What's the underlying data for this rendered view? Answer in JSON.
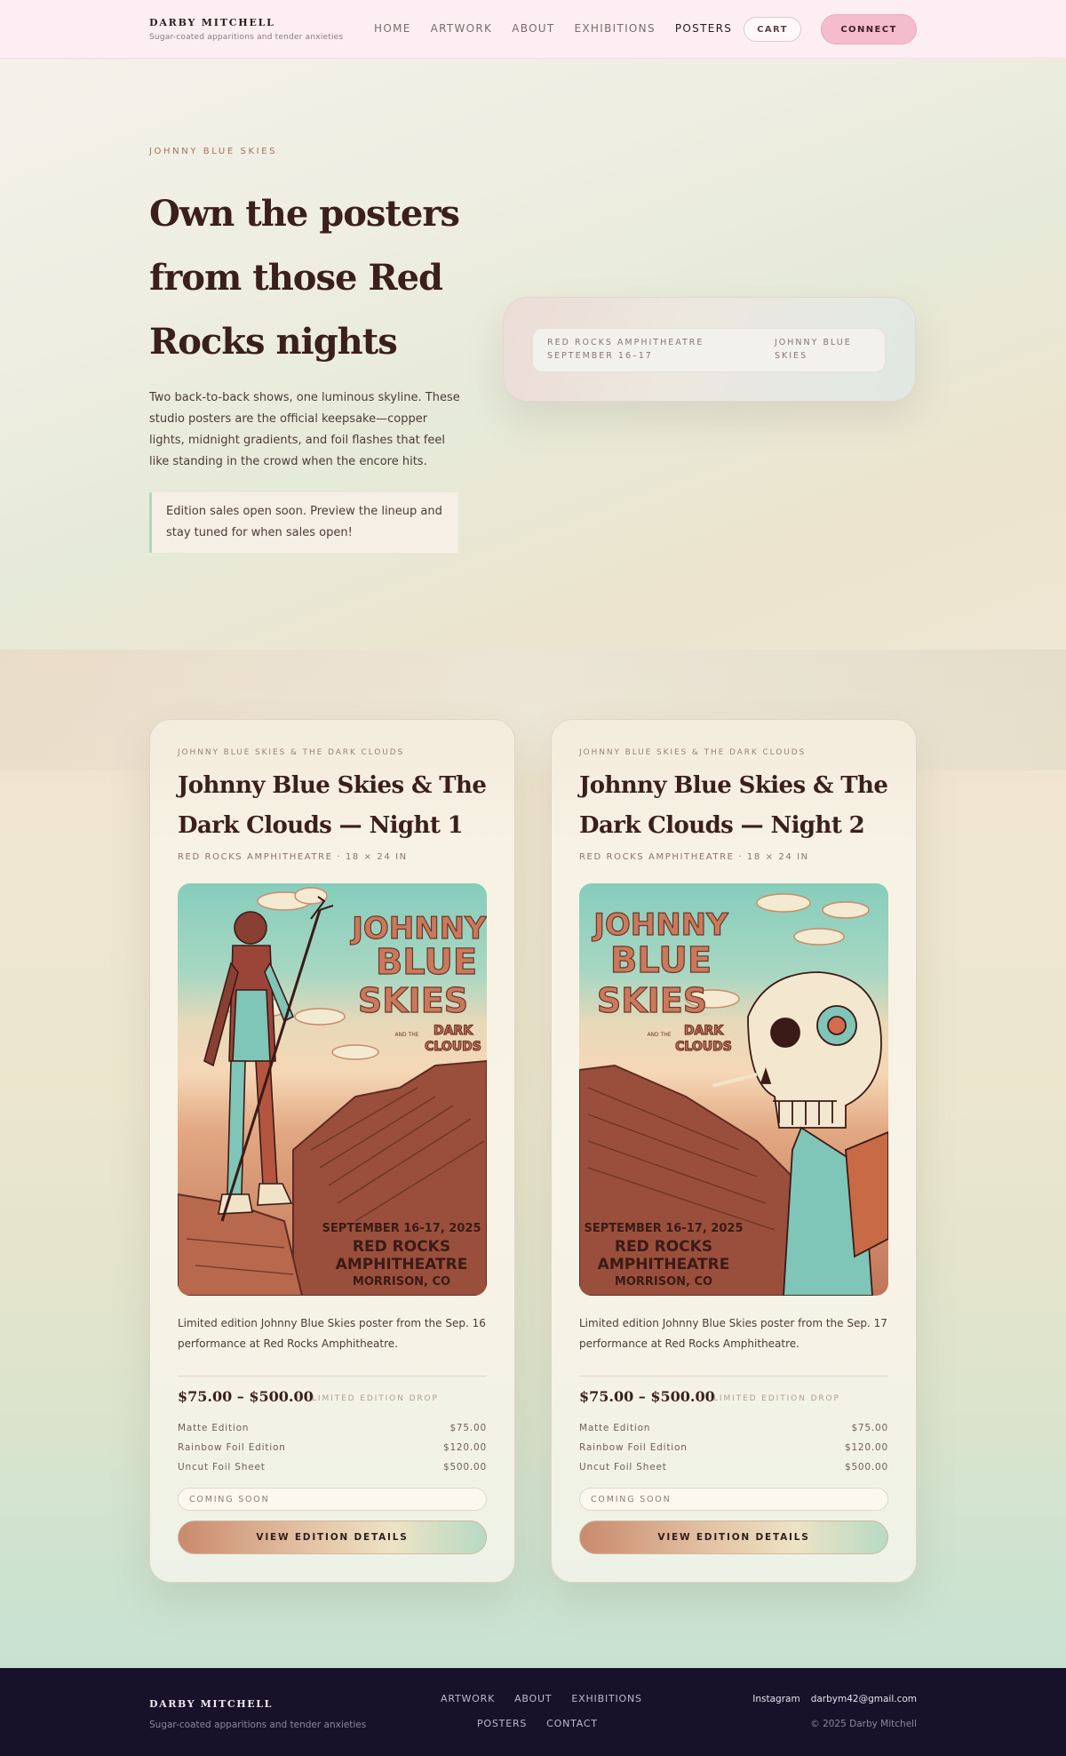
{
  "header": {
    "brand_name": "DARBY MITCHELL",
    "brand_tagline": "Sugar-coated apparitions and tender anxieties",
    "nav": [
      "HOME",
      "ARTWORK",
      "ABOUT",
      "EXHIBITIONS",
      "POSTERS"
    ],
    "active_nav": "POSTERS",
    "cart_label": "CART",
    "connect_label": "CONNECT"
  },
  "hero": {
    "eyebrow": "JOHNNY BLUE SKIES",
    "title": "Own the posters from those Red Rocks nights",
    "paragraph": "Two back-to-back shows, one luminous skyline. These studio posters are the official keepsake—copper lights, midnight gradients, and foil flashes that feel like standing in the crowd when the encore hits.",
    "notice": "Edition sales open soon. Preview the lineup and stay tuned for when sales open!",
    "info": {
      "venue": "RED ROCKS AMPHITHEATRE",
      "dates": "SEPTEMBER 16–17",
      "artist_line1": "JOHNNY BLUE",
      "artist_line2": "SKIES"
    }
  },
  "products": [
    {
      "eyebrow": "JOHNNY BLUE SKIES & THE DARK CLOUDS",
      "title": "Johnny Blue Skies & The Dark Clouds — Night 1",
      "meta": "RED ROCKS AMPHITHEATRE · 18 × 24 IN",
      "poster": {
        "logo_line1": "JOHNNY",
        "logo_line2": "BLUE",
        "logo_line3": "SKIES",
        "logo_and": "AND THE",
        "logo_dark": "DARK",
        "logo_clouds": "CLOUDS",
        "date": "SEPTEMBER 16-17, 2025",
        "venue1": "RED ROCKS",
        "venue2": "AMPHITHEATRE",
        "city": "MORRISON, CO"
      },
      "description": "Limited edition Johnny Blue Skies poster from the Sep. 16 performance at Red Rocks Amphitheatre.",
      "price_range": "$75.00 – $500.00",
      "drop_label": "LIMITED EDITION DROP",
      "editions": [
        {
          "name": "Matte Edition",
          "price": "$75.00"
        },
        {
          "name": "Rainbow Foil Edition",
          "price": "$120.00"
        },
        {
          "name": "Uncut Foil Sheet",
          "price": "$500.00"
        }
      ],
      "status": "COMING SOON",
      "cta": "VIEW EDITION DETAILS"
    },
    {
      "eyebrow": "JOHNNY BLUE SKIES & THE DARK CLOUDS",
      "title": "Johnny Blue Skies & The Dark Clouds — Night 2",
      "meta": "RED ROCKS AMPHITHEATRE · 18 × 24 IN",
      "poster": {
        "logo_line1": "JOHNNY",
        "logo_line2": "BLUE",
        "logo_line3": "SKIES",
        "logo_and": "AND THE",
        "logo_dark": "DARK",
        "logo_clouds": "CLOUDS",
        "date": "SEPTEMBER 16-17, 2025",
        "venue1": "RED ROCKS",
        "venue2": "AMPHITHEATRE",
        "city": "MORRISON, CO"
      },
      "description": "Limited edition Johnny Blue Skies poster from the Sep. 17 performance at Red Rocks Amphitheatre.",
      "price_range": "$75.00 – $500.00",
      "drop_label": "LIMITED EDITION DROP",
      "editions": [
        {
          "name": "Matte Edition",
          "price": "$75.00"
        },
        {
          "name": "Rainbow Foil Edition",
          "price": "$120.00"
        },
        {
          "name": "Uncut Foil Sheet",
          "price": "$500.00"
        }
      ],
      "status": "COMING SOON",
      "cta": "VIEW EDITION DETAILS"
    }
  ],
  "footer": {
    "brand_name": "DARBY MITCHELL",
    "brand_tagline": "Sugar-coated apparitions and tender anxieties",
    "links_row1": [
      "ARTWORK",
      "ABOUT",
      "EXHIBITIONS"
    ],
    "links_row2": [
      "POSTERS",
      "CONTACT"
    ],
    "social_instagram": "Instagram",
    "social_email": "darbym42@gmail.com",
    "copyright": "© 2025 Darby Mitchell"
  },
  "colors": {
    "header_bg": "#fdeef3",
    "accent_pink": "#f4bccd",
    "title_brown": "#3b1f1c",
    "eyebrow_copper": "#a0745a",
    "notice_border_mint": "#b7d5c0",
    "footer_bg": "#17112a"
  }
}
